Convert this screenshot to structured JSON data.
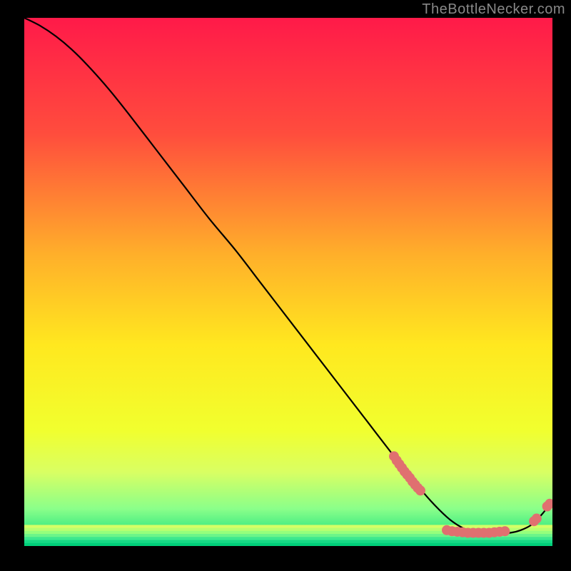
{
  "watermark": "TheBottleNecker.com",
  "chart_data": {
    "type": "line",
    "title": "",
    "xlabel": "",
    "ylabel": "",
    "xlim": [
      0,
      100
    ],
    "ylim": [
      0,
      100
    ],
    "gradient_stops": [
      {
        "offset": 0,
        "color": "#ff1a49"
      },
      {
        "offset": 0.22,
        "color": "#ff4d3d"
      },
      {
        "offset": 0.45,
        "color": "#ffb02a"
      },
      {
        "offset": 0.62,
        "color": "#ffe81f"
      },
      {
        "offset": 0.78,
        "color": "#f1ff2e"
      },
      {
        "offset": 0.86,
        "color": "#d9ff63"
      },
      {
        "offset": 0.93,
        "color": "#8aff8a"
      },
      {
        "offset": 1.0,
        "color": "#00d97a"
      }
    ],
    "green_band": {
      "y_start": 96,
      "y_end": 100
    },
    "series": [
      {
        "name": "curve",
        "x": [
          0,
          3,
          6,
          9,
          12,
          16,
          20,
          25,
          30,
          35,
          40,
          45,
          50,
          55,
          60,
          65,
          70,
          74,
          77,
          80,
          82,
          84,
          86,
          88,
          90,
          92,
          94,
          96,
          98,
          100
        ],
        "y": [
          0,
          1.5,
          3.5,
          6,
          9,
          13.5,
          18.5,
          25,
          31.5,
          38,
          44,
          50.5,
          57,
          63.5,
          70,
          76.5,
          83,
          88,
          91.5,
          94.5,
          96,
          97,
          97.5,
          97.5,
          97.5,
          97.5,
          97,
          96,
          94,
          91.5
        ]
      }
    ],
    "points": {
      "name": "markers",
      "color": "#e07070",
      "radius": 7,
      "coords": [
        [
          70.0,
          83.0
        ],
        [
          70.5,
          83.8
        ],
        [
          71.0,
          84.5
        ],
        [
          71.5,
          85.2
        ],
        [
          72.0,
          85.9
        ],
        [
          72.5,
          86.5
        ],
        [
          73.0,
          87.1
        ],
        [
          73.5,
          87.8
        ],
        [
          74.0,
          88.4
        ],
        [
          74.5,
          89.0
        ],
        [
          75.0,
          89.5
        ],
        [
          80.0,
          97.0
        ],
        [
          81.0,
          97.2
        ],
        [
          82.0,
          97.3
        ],
        [
          83.0,
          97.4
        ],
        [
          84.0,
          97.5
        ],
        [
          85.0,
          97.5
        ],
        [
          86.0,
          97.5
        ],
        [
          87.0,
          97.5
        ],
        [
          88.0,
          97.5
        ],
        [
          89.0,
          97.4
        ],
        [
          90.0,
          97.3
        ],
        [
          91.0,
          97.2
        ],
        [
          96.5,
          95.3
        ],
        [
          97.0,
          94.8
        ],
        [
          99.0,
          92.5
        ],
        [
          99.5,
          92.0
        ]
      ]
    }
  }
}
